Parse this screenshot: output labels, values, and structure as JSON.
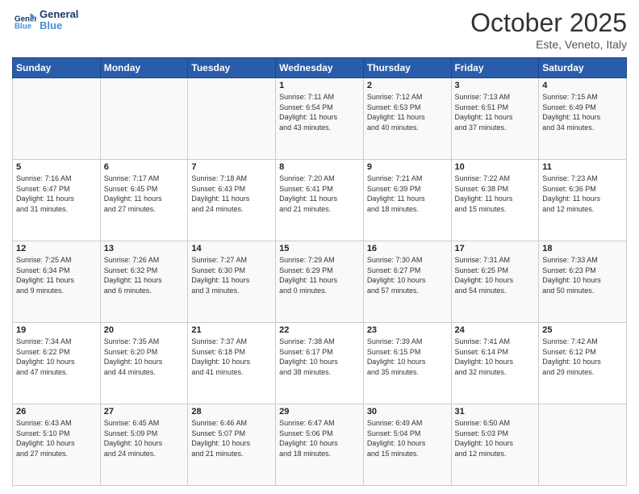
{
  "header": {
    "logo_line1": "General",
    "logo_line2": "Blue",
    "month": "October 2025",
    "location": "Este, Veneto, Italy"
  },
  "days_of_week": [
    "Sunday",
    "Monday",
    "Tuesday",
    "Wednesday",
    "Thursday",
    "Friday",
    "Saturday"
  ],
  "weeks": [
    [
      {
        "day": "",
        "info": ""
      },
      {
        "day": "",
        "info": ""
      },
      {
        "day": "",
        "info": ""
      },
      {
        "day": "1",
        "info": "Sunrise: 7:11 AM\nSunset: 6:54 PM\nDaylight: 11 hours\nand 43 minutes."
      },
      {
        "day": "2",
        "info": "Sunrise: 7:12 AM\nSunset: 6:53 PM\nDaylight: 11 hours\nand 40 minutes."
      },
      {
        "day": "3",
        "info": "Sunrise: 7:13 AM\nSunset: 6:51 PM\nDaylight: 11 hours\nand 37 minutes."
      },
      {
        "day": "4",
        "info": "Sunrise: 7:15 AM\nSunset: 6:49 PM\nDaylight: 11 hours\nand 34 minutes."
      }
    ],
    [
      {
        "day": "5",
        "info": "Sunrise: 7:16 AM\nSunset: 6:47 PM\nDaylight: 11 hours\nand 31 minutes."
      },
      {
        "day": "6",
        "info": "Sunrise: 7:17 AM\nSunset: 6:45 PM\nDaylight: 11 hours\nand 27 minutes."
      },
      {
        "day": "7",
        "info": "Sunrise: 7:18 AM\nSunset: 6:43 PM\nDaylight: 11 hours\nand 24 minutes."
      },
      {
        "day": "8",
        "info": "Sunrise: 7:20 AM\nSunset: 6:41 PM\nDaylight: 11 hours\nand 21 minutes."
      },
      {
        "day": "9",
        "info": "Sunrise: 7:21 AM\nSunset: 6:39 PM\nDaylight: 11 hours\nand 18 minutes."
      },
      {
        "day": "10",
        "info": "Sunrise: 7:22 AM\nSunset: 6:38 PM\nDaylight: 11 hours\nand 15 minutes."
      },
      {
        "day": "11",
        "info": "Sunrise: 7:23 AM\nSunset: 6:36 PM\nDaylight: 11 hours\nand 12 minutes."
      }
    ],
    [
      {
        "day": "12",
        "info": "Sunrise: 7:25 AM\nSunset: 6:34 PM\nDaylight: 11 hours\nand 9 minutes."
      },
      {
        "day": "13",
        "info": "Sunrise: 7:26 AM\nSunset: 6:32 PM\nDaylight: 11 hours\nand 6 minutes."
      },
      {
        "day": "14",
        "info": "Sunrise: 7:27 AM\nSunset: 6:30 PM\nDaylight: 11 hours\nand 3 minutes."
      },
      {
        "day": "15",
        "info": "Sunrise: 7:29 AM\nSunset: 6:29 PM\nDaylight: 11 hours\nand 0 minutes."
      },
      {
        "day": "16",
        "info": "Sunrise: 7:30 AM\nSunset: 6:27 PM\nDaylight: 10 hours\nand 57 minutes."
      },
      {
        "day": "17",
        "info": "Sunrise: 7:31 AM\nSunset: 6:25 PM\nDaylight: 10 hours\nand 54 minutes."
      },
      {
        "day": "18",
        "info": "Sunrise: 7:33 AM\nSunset: 6:23 PM\nDaylight: 10 hours\nand 50 minutes."
      }
    ],
    [
      {
        "day": "19",
        "info": "Sunrise: 7:34 AM\nSunset: 6:22 PM\nDaylight: 10 hours\nand 47 minutes."
      },
      {
        "day": "20",
        "info": "Sunrise: 7:35 AM\nSunset: 6:20 PM\nDaylight: 10 hours\nand 44 minutes."
      },
      {
        "day": "21",
        "info": "Sunrise: 7:37 AM\nSunset: 6:18 PM\nDaylight: 10 hours\nand 41 minutes."
      },
      {
        "day": "22",
        "info": "Sunrise: 7:38 AM\nSunset: 6:17 PM\nDaylight: 10 hours\nand 38 minutes."
      },
      {
        "day": "23",
        "info": "Sunrise: 7:39 AM\nSunset: 6:15 PM\nDaylight: 10 hours\nand 35 minutes."
      },
      {
        "day": "24",
        "info": "Sunrise: 7:41 AM\nSunset: 6:14 PM\nDaylight: 10 hours\nand 32 minutes."
      },
      {
        "day": "25",
        "info": "Sunrise: 7:42 AM\nSunset: 6:12 PM\nDaylight: 10 hours\nand 29 minutes."
      }
    ],
    [
      {
        "day": "26",
        "info": "Sunrise: 6:43 AM\nSunset: 5:10 PM\nDaylight: 10 hours\nand 27 minutes."
      },
      {
        "day": "27",
        "info": "Sunrise: 6:45 AM\nSunset: 5:09 PM\nDaylight: 10 hours\nand 24 minutes."
      },
      {
        "day": "28",
        "info": "Sunrise: 6:46 AM\nSunset: 5:07 PM\nDaylight: 10 hours\nand 21 minutes."
      },
      {
        "day": "29",
        "info": "Sunrise: 6:47 AM\nSunset: 5:06 PM\nDaylight: 10 hours\nand 18 minutes."
      },
      {
        "day": "30",
        "info": "Sunrise: 6:49 AM\nSunset: 5:04 PM\nDaylight: 10 hours\nand 15 minutes."
      },
      {
        "day": "31",
        "info": "Sunrise: 6:50 AM\nSunset: 5:03 PM\nDaylight: 10 hours\nand 12 minutes."
      },
      {
        "day": "",
        "info": ""
      }
    ]
  ]
}
